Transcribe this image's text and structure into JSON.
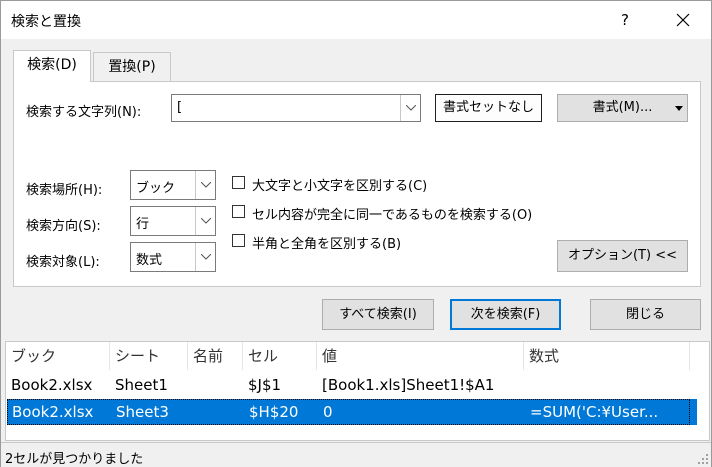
{
  "window": {
    "title": "検索と置換",
    "help": "?",
    "close_icon": "close-icon"
  },
  "tabs": [
    {
      "label": "検索(D)",
      "active": true
    },
    {
      "label": "置換(P)",
      "active": false
    }
  ],
  "find": {
    "label": "検索する文字列(N):",
    "value": "[",
    "no_format_label": "書式セットなし",
    "format_label": "書式(M)..."
  },
  "options": {
    "within": {
      "label": "検索場所(H):",
      "value": "ブック"
    },
    "search": {
      "label": "検索方向(S):",
      "value": "行"
    },
    "look_in": {
      "label": "検索対象(L):",
      "value": "数式"
    },
    "checkboxes": [
      {
        "label": "大文字と小文字を区別する(C)",
        "checked": false
      },
      {
        "label": "セル内容が完全に同一であるものを検索する(O)",
        "checked": false
      },
      {
        "label": "半角と全角を区別する(B)",
        "checked": false
      }
    ],
    "options_button": "オプション(T) <<"
  },
  "buttons": {
    "find_all": "すべて検索(I)",
    "find_next": "次を検索(F)",
    "close": "閉じる"
  },
  "results": {
    "columns": [
      "ブック",
      "シート",
      "名前",
      "セル",
      "値",
      "数式"
    ],
    "rows": [
      {
        "book": "Book2.xlsx",
        "sheet": "Sheet1",
        "name": "",
        "cell": "$J$1",
        "value": "[Book1.xls]Sheet1!$A1",
        "formula": "",
        "selected": false
      },
      {
        "book": "Book2.xlsx",
        "sheet": "Sheet3",
        "name": "",
        "cell": "$H$20",
        "value": "0",
        "formula": "=SUM('C:¥User...",
        "selected": true
      }
    ]
  },
  "status": "2セルが見つかりました",
  "colors": {
    "selection": "#0078d7",
    "default_button_border": "#0078d7"
  }
}
